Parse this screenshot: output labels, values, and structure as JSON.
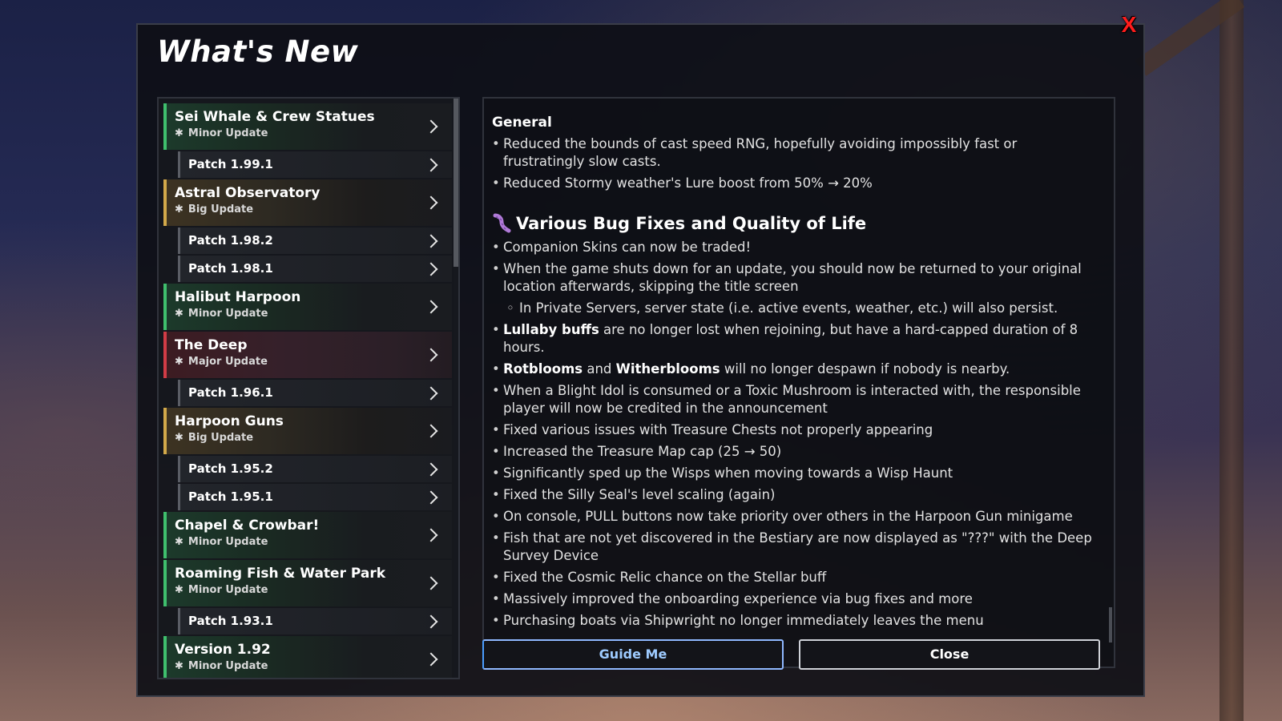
{
  "window": {
    "title": "What's New",
    "close_glyph": "X"
  },
  "sidebar": {
    "items": [
      {
        "type": "update",
        "color": "green",
        "title": "Sei Whale & Crew Statues",
        "subtitle": "Minor Update"
      },
      {
        "type": "patch",
        "title": "Patch 1.99.1"
      },
      {
        "type": "update",
        "color": "gold",
        "title": "Astral Observatory",
        "subtitle": "Big Update"
      },
      {
        "type": "patch",
        "title": "Patch 1.98.2"
      },
      {
        "type": "patch",
        "title": "Patch 1.98.1"
      },
      {
        "type": "update",
        "color": "green",
        "title": "Halibut Harpoon",
        "subtitle": "Minor Update"
      },
      {
        "type": "update",
        "color": "red",
        "title": "The Deep",
        "subtitle": "Major Update"
      },
      {
        "type": "patch",
        "title": "Patch 1.96.1"
      },
      {
        "type": "update",
        "color": "gold",
        "title": "Harpoon Guns",
        "subtitle": "Big Update"
      },
      {
        "type": "patch",
        "title": "Patch 1.95.2"
      },
      {
        "type": "patch",
        "title": "Patch 1.95.1"
      },
      {
        "type": "update",
        "color": "green",
        "title": "Chapel & Crowbar!",
        "subtitle": "Minor Update"
      },
      {
        "type": "update",
        "color": "green",
        "title": "Roaming Fish & Water Park",
        "subtitle": "Minor Update"
      },
      {
        "type": "patch",
        "title": "Patch 1.93.1"
      },
      {
        "type": "update",
        "color": "green",
        "title": "Version 1.92",
        "subtitle": "Minor Update"
      }
    ]
  },
  "content": {
    "general": {
      "heading": "General",
      "bullets": [
        "Reduced the bounds of cast speed RNG, hopefully avoiding impossibly fast or frustratingly slow casts.",
        "Reduced Stormy weather's Lure boost from 50% → 20%"
      ]
    },
    "fixes": {
      "heading": "Various Bug Fixes and Quality of Life",
      "b1": "Companion Skins can now be traded!",
      "b2": "When the game shuts down for an update, you should now be returned to your original location afterwards, skipping the title screen",
      "b2_sub": "In Private Servers, server state (i.e. active events, weather, etc.) will also persist.",
      "b3_bold": "Lullaby buffs",
      "b3_rest": " are no longer lost when rejoining, but have a hard-capped duration of 8 hours.",
      "b4_bold1": "Rotblooms",
      "b4_mid": " and ",
      "b4_bold2": "Witherblooms",
      "b4_rest": " will no longer despawn if nobody is nearby.",
      "b5": "When a Blight Idol is consumed or a Toxic Mushroom is interacted with, the responsible player will now be credited in the announcement",
      "b6": "Fixed various issues with Treasure Chests not properly appearing",
      "b7": "Increased the Treasure Map cap (25 → 50)",
      "b8": "Significantly sped up the Wisps when moving towards a Wisp Haunt",
      "b9": "Fixed the Silly Seal's level scaling (again)",
      "b10": "On console, PULL buttons now take priority over others in the Harpoon Gun minigame",
      "b11": "Fish that are not yet discovered in the Bestiary are now displayed as \"???\" with the Deep Survey Device",
      "b12": "Fixed the Cosmic Relic chance on the Stellar buff",
      "b13": "Massively improved the onboarding experience via bug fixes and more",
      "b14": "Purchasing boats via Shipwright no longer immediately leaves the menu"
    }
  },
  "buttons": {
    "guide_label": "Guide Me",
    "close_label": "Close"
  },
  "icons": {
    "fixes_heading_icon": "worm-icon",
    "update_star": "✱"
  },
  "colors": {
    "close_x": "#ff1c1c",
    "minor_update": "#3fbf6d",
    "big_update": "#d2a94a",
    "major_update": "#d23c46",
    "guide_button_text": "#9ecbff"
  }
}
